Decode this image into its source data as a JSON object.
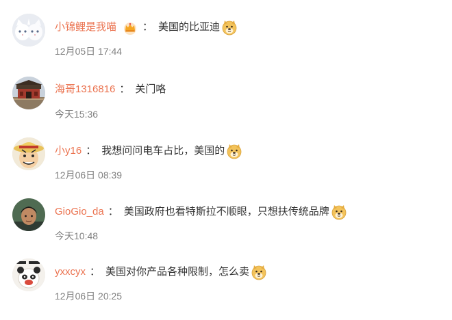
{
  "comments": [
    {
      "username": "小锦鲤是我喵",
      "has_crown_icon": true,
      "separator": "：",
      "text": "美国的比亚迪",
      "time": "12月05日 17:44",
      "avatar_icon": "white-cats-avatar",
      "emoji_icon": "doge-emoji-icon"
    },
    {
      "username": "海哥1316816",
      "has_crown_icon": false,
      "separator": "：",
      "text": "关门咯",
      "time": "今天15:36",
      "avatar_icon": "palace-gate-avatar",
      "emoji_icon": null
    },
    {
      "username": "小y16",
      "has_crown_icon": false,
      "separator": "：",
      "text": "我想问问电车占比，美国的",
      "time": "12月06日 08:39",
      "avatar_icon": "straw-hat-avatar",
      "emoji_icon": "doge-emoji-icon"
    },
    {
      "username": "GioGio_da",
      "has_crown_icon": false,
      "separator": "：",
      "text": "美国政府也看特斯拉不顺眼，只想扶传统品牌",
      "time": "今天10:48",
      "avatar_icon": "person-photo-avatar",
      "emoji_icon": "doge-emoji-icon"
    },
    {
      "username": "yxxcyx",
      "has_crown_icon": false,
      "separator": "：",
      "text": "美国对你产品各种限制，怎么卖",
      "time": "12月06日 20:25",
      "avatar_icon": "panda-cartoon-avatar",
      "emoji_icon": "doge-emoji-icon"
    }
  ],
  "colors": {
    "username": "#eb7350",
    "text": "#333333",
    "time": "#808080",
    "background": "#ffffff"
  }
}
